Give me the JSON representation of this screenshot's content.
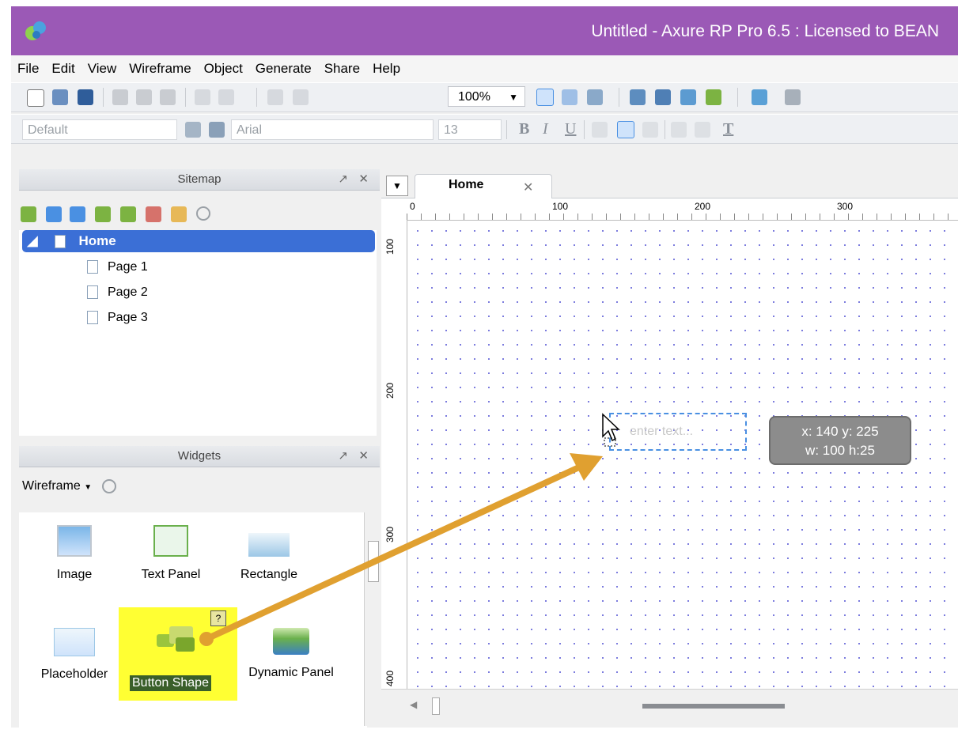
{
  "window": {
    "title": "Untitled - Axure RP Pro 6.5 : Licensed to BEAN"
  },
  "menu": [
    "File",
    "Edit",
    "View",
    "Wireframe",
    "Object",
    "Generate",
    "Share",
    "Help"
  ],
  "toolbar": {
    "zoom": "100%",
    "style_select": "Default",
    "font_select": "Arial",
    "font_size": "13",
    "bold_label": "B",
    "italic_label": "I",
    "underline_label": "U",
    "text_color_label": "T"
  },
  "sitemap": {
    "title": "Sitemap",
    "home": "Home",
    "pages": [
      "Page 1",
      "Page 2",
      "Page 3"
    ]
  },
  "widgets": {
    "title": "Widgets",
    "library": "Wireframe",
    "items": [
      {
        "label": "Image",
        "icon": "image-icon"
      },
      {
        "label": "Text Panel",
        "icon": "text-panel-icon"
      },
      {
        "label": "Rectangle",
        "icon": "rectangle-icon"
      },
      {
        "label": "Placeholder",
        "icon": "placeholder-icon"
      },
      {
        "label": "Button Shape",
        "icon": "button-shape-icon"
      },
      {
        "label": "Dynamic Panel",
        "icon": "dynamic-panel-icon"
      }
    ],
    "help_badge": "?"
  },
  "canvas": {
    "tab": "Home",
    "ruler_h": [
      "0",
      "100",
      "200",
      "300"
    ],
    "ruler_v": [
      "100",
      "200",
      "300",
      "400"
    ],
    "placeholder_text": "enter text...",
    "tooltip_line1": "x: 140  y: 225",
    "tooltip_line2": "w: 100  h:25"
  },
  "colors": {
    "titlebar": "#9b59b6",
    "selection": "#3b6fd6",
    "highlight": "#ffff33",
    "arrow": "#e0a030"
  }
}
